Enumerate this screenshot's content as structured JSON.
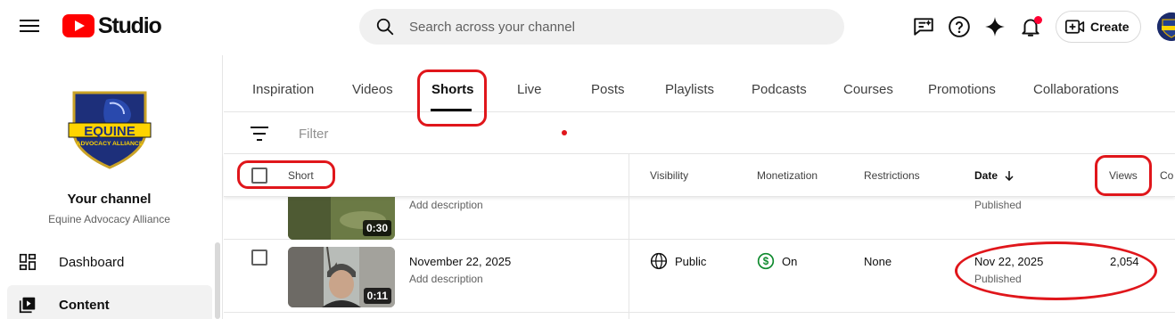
{
  "header": {
    "logo_text": "Studio",
    "search_placeholder": "Search across your channel",
    "create_label": "Create",
    "icons": [
      "hamburger-menu-icon",
      "youtube-logo-icon",
      "search-icon",
      "feedback-icon",
      "help-icon",
      "sparkle-icon",
      "notifications-icon",
      "create-video-icon",
      "account-avatar"
    ],
    "notification_dot_color": "#ff0033"
  },
  "sidebar": {
    "channel_logo_text": "EQUINE",
    "channel_logo_subtext": "ADVOCACY ALLIANCE",
    "your_channel_label": "Your channel",
    "channel_name": "Equine Advocacy Alliance",
    "items": [
      {
        "label": "Dashboard",
        "icon": "dashboard-icon",
        "active": false
      },
      {
        "label": "Content",
        "icon": "content-icon",
        "active": true
      }
    ]
  },
  "tabs": [
    {
      "label": "Inspiration",
      "active": false
    },
    {
      "label": "Videos",
      "active": false
    },
    {
      "label": "Shorts",
      "active": true
    },
    {
      "label": "Live",
      "active": false
    },
    {
      "label": "Posts",
      "active": false
    },
    {
      "label": "Playlists",
      "active": false
    },
    {
      "label": "Podcasts",
      "active": false
    },
    {
      "label": "Courses",
      "active": false
    },
    {
      "label": "Promotions",
      "active": false
    },
    {
      "label": "Collaborations",
      "active": false
    }
  ],
  "filter": {
    "placeholder": "Filter",
    "icon": "filter-icon"
  },
  "table": {
    "columns": {
      "short": "Short",
      "visibility": "Visibility",
      "monetization": "Monetization",
      "restrictions": "Restrictions",
      "date": "Date",
      "views": "Views",
      "comments_truncated": "Co"
    },
    "sort_icon": "arrow-down-icon",
    "rows": [
      {
        "duration": "0:30",
        "title": "",
        "description": "Add description",
        "visibility": "",
        "monetization": "",
        "restrictions": "",
        "date": "",
        "date_status": "Published",
        "views": ""
      },
      {
        "duration": "0:11",
        "title": "November 22, 2025",
        "description": "Add description",
        "visibility": "Public",
        "visibility_icon": "globe-icon",
        "monetization": "On",
        "monetization_icon": "dollar-circle-icon",
        "restrictions": "None",
        "date": "Nov 22, 2025",
        "date_status": "Published",
        "views": "2,054"
      }
    ]
  },
  "colors": {
    "brand_red": "#ff0000",
    "annotation_red": "#e0161b",
    "monetization_green": "#0f8a2e"
  }
}
